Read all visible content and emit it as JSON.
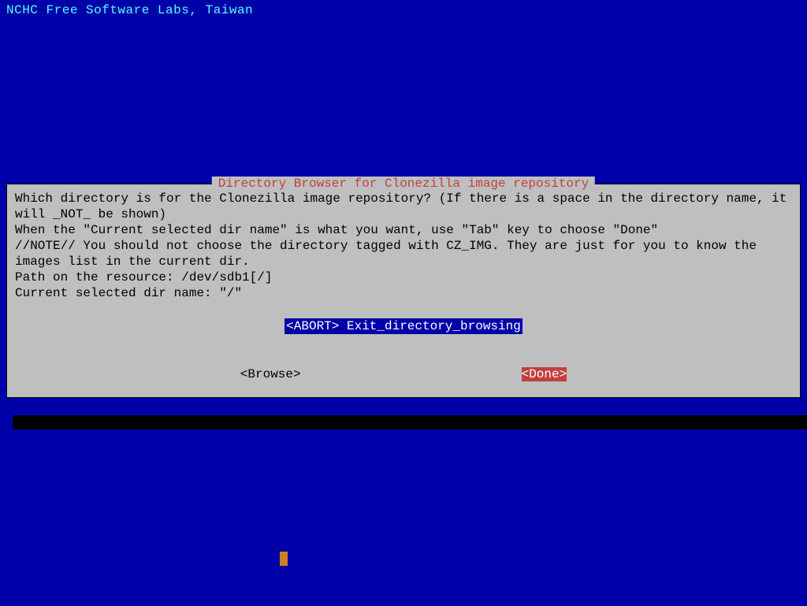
{
  "header": {
    "title": "NCHC Free Software Labs, Taiwan"
  },
  "dialog": {
    "title": "Directory Browser for Clonezilla image repository",
    "body_line1": "Which directory is for the Clonezilla image repository? (If there is a space in the directory name, it will _NOT_ be shown)",
    "body_line2": "When the \"Current selected dir name\" is what you want, use \"Tab\" key to choose \"Done\"",
    "body_line3": "//NOTE// You should not choose the directory tagged with CZ_IMG. They are just for you to know the images list in the current dir.",
    "body_line4": "Path on the resource: /dev/sdb1[/]",
    "body_line5": "Current selected dir name: \"/\"",
    "menu_item": "<ABORT>  Exit_directory_browsing ",
    "browse_button": "<Browse>",
    "done_button": "<Done>"
  }
}
